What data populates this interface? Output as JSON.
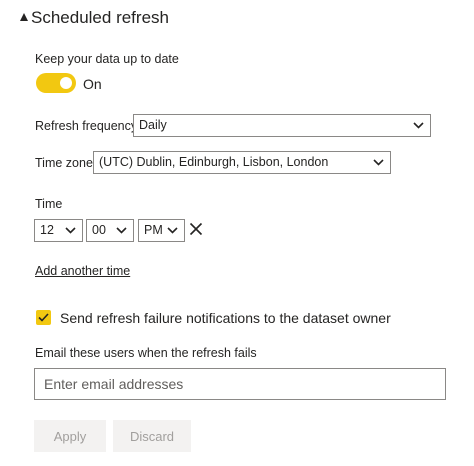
{
  "section": {
    "title": "Scheduled refresh",
    "caret_icon": "caret-expanded-icon"
  },
  "keep_up_to_date": {
    "label": "Keep your data up to date",
    "toggle_state": "On",
    "toggle_on": true
  },
  "refresh_frequency": {
    "label": "Refresh frequency",
    "value": "Daily"
  },
  "time_zone": {
    "label": "Time zone",
    "value": "(UTC) Dublin, Edinburgh, Lisbon, London"
  },
  "time": {
    "label": "Time",
    "hour": "12",
    "minute": "00",
    "period": "PM",
    "remove_icon": "close-icon"
  },
  "add_time_link": "Add another time",
  "notifications": {
    "checked": true,
    "label": "Send refresh failure notifications to the dataset owner"
  },
  "email": {
    "label": "Email these users when the refresh fails",
    "placeholder": "Enter email addresses",
    "value": ""
  },
  "buttons": {
    "apply": "Apply",
    "discard": "Discard",
    "enabled": false
  },
  "colors": {
    "accent": "#f2c811",
    "border": "#8a8886",
    "disabled_bg": "#f3f2f1",
    "disabled_text": "#a19f9d",
    "text": "#252423"
  }
}
